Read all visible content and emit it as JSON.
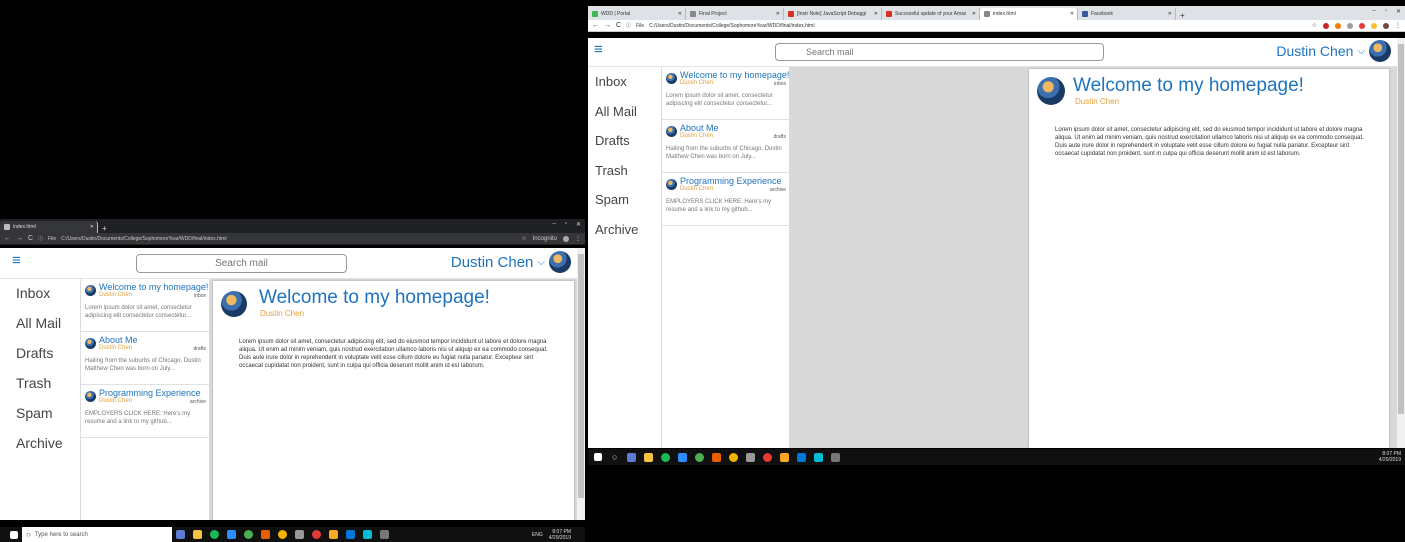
{
  "browser": {
    "left_window": {
      "tab_title": "index.html",
      "url_scheme": "File",
      "url": "C:/Users/Dustin/Documents/College/SophomoreYear/WDD/final/index.html",
      "incognito_label": "Incognito"
    },
    "right_window": {
      "tabs": [
        {
          "title": "WDD | Portal",
          "color": "#3cba54"
        },
        {
          "title": "Final Project",
          "color": "#888888"
        },
        {
          "title": "[Instr Note] JavaScript Debuggi",
          "color": "#d93025"
        },
        {
          "title": "Successful update of your Amaz",
          "color": "#d93025"
        },
        {
          "title": "index.html",
          "color": "#888888",
          "active": true
        },
        {
          "title": "Facebook",
          "color": "#3b5998"
        }
      ],
      "url_scheme": "File",
      "url": "C:/Users/Dustin/Documents/College/SophomoreYear/WDD/final/index.html"
    }
  },
  "app": {
    "search_placeholder": "Search mail",
    "user_name": "Dustin Chen",
    "folders": [
      {
        "label": "Inbox"
      },
      {
        "label": "All Mail"
      },
      {
        "label": "Drafts"
      },
      {
        "label": "Trash"
      },
      {
        "label": "Spam"
      },
      {
        "label": "Archive"
      }
    ],
    "messages": [
      {
        "subject": "Welcome to my homepage!",
        "from": "Dustin Chen",
        "tag": "inbox",
        "preview": "Lorem ipsum dolor sit amet, consectetur adipiscing elit consectetur consectetur..."
      },
      {
        "subject": "About Me",
        "from": "Dustin Chen",
        "tag": "drafts",
        "preview": "Hailing from the suburbs of Chicago, Dustin Matthew Chen was born on July..."
      },
      {
        "subject": "Programming Experience",
        "from": "Dustin Chen",
        "tag": "archive",
        "preview": "EMPLOYERS CLICK HERE: Here's my resume and a link to my github..."
      }
    ],
    "reading": {
      "title": "Welcome to my homepage!",
      "from": "Dustin Chen",
      "body": "Lorem ipsum dolor sit amet, consectetur adipiscing elit, sed do eiusmod tempor incididunt ut labore et dolore magna aliqua. Ut enim ad minim veniam, quis nostrud exercitation ullamco laboris nisi ut aliquip ex ea commodo consequat. Duis aute irure dolor in reprehenderit in voluptate velit esse cillum dolore eu fugiat nulla pariatur. Excepteur sint occaecat cupidatat non proident, sunt in culpa qui officia deserunt mollit anim id est laborum."
    }
  },
  "taskbar": {
    "search_placeholder": "Type here to search",
    "language": "ENG",
    "time": "8:07 PM",
    "date": "4/29/2019"
  }
}
